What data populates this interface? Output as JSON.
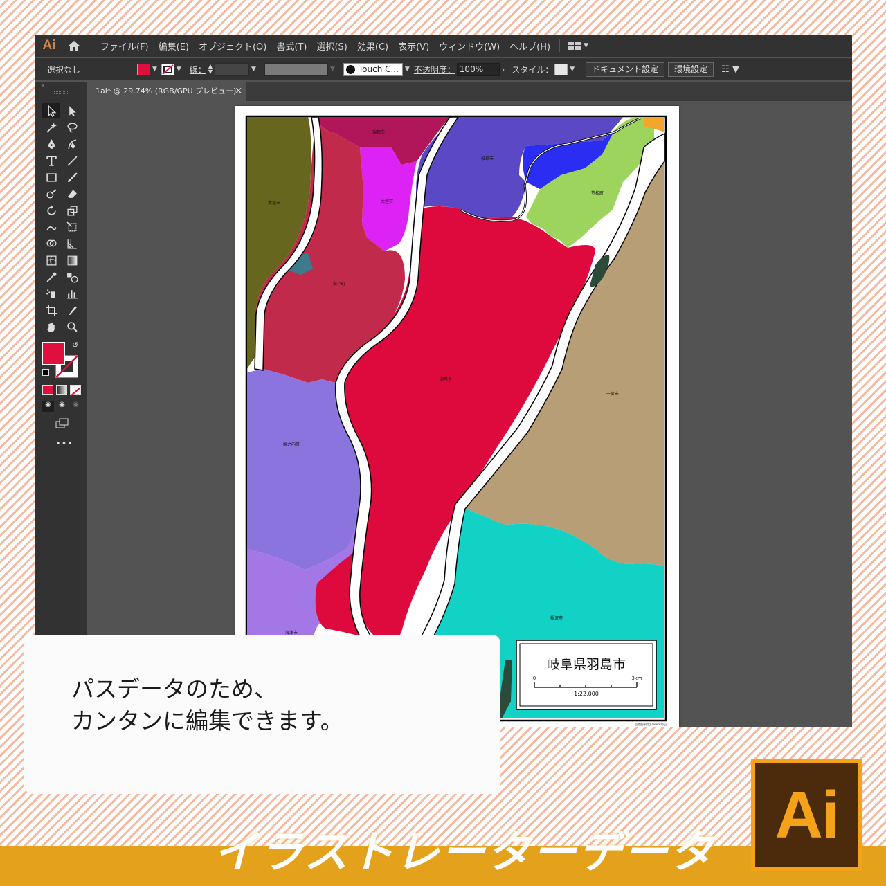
{
  "app": {
    "logo": "Ai",
    "menu": [
      "ファイル(F)",
      "編集(E)",
      "オブジェクト(O)",
      "書式(T)",
      "選択(S)",
      "効果(C)",
      "表示(V)",
      "ウィンドウ(W)",
      "ヘルプ(H)"
    ]
  },
  "control_bar": {
    "selection_label": "選択なし",
    "fill_color": "#e0103e",
    "stroke_label": "線：",
    "brush_label": "Touch C...",
    "opacity_label": "不透明度：",
    "opacity_value": "100%",
    "style_label": "スタイル：",
    "document_settings": "ドキュメント設定",
    "preferences": "環境設定"
  },
  "document": {
    "tab_title": "1ai* @ 29.74% (RGB/GPU プレビュー)",
    "close": "×"
  },
  "map": {
    "labels": {
      "mizuho": "瑞穂市",
      "gifu": "岐阜市",
      "ogaki_w": "大垣市",
      "ogaki_c": "大垣市",
      "kasamatsu": "笠松町",
      "anpachi": "安八町",
      "hashima": "羽島市",
      "ichinomiya": "一宮市",
      "wanouchi": "輪之内町",
      "inazawa": "稲沢市",
      "kaizu": "海津市"
    },
    "title": "岐阜県羽島市",
    "scale_start": "0",
    "scale_end": "3km",
    "ratio": "1:22,000",
    "credit": "白地図専門店 freemap.jp"
  },
  "caption": {
    "line1": "パスデータのため、",
    "line2": "カンタンに編集できます。"
  },
  "banner": "イラストレーターデータ",
  "badge": "Ai"
}
